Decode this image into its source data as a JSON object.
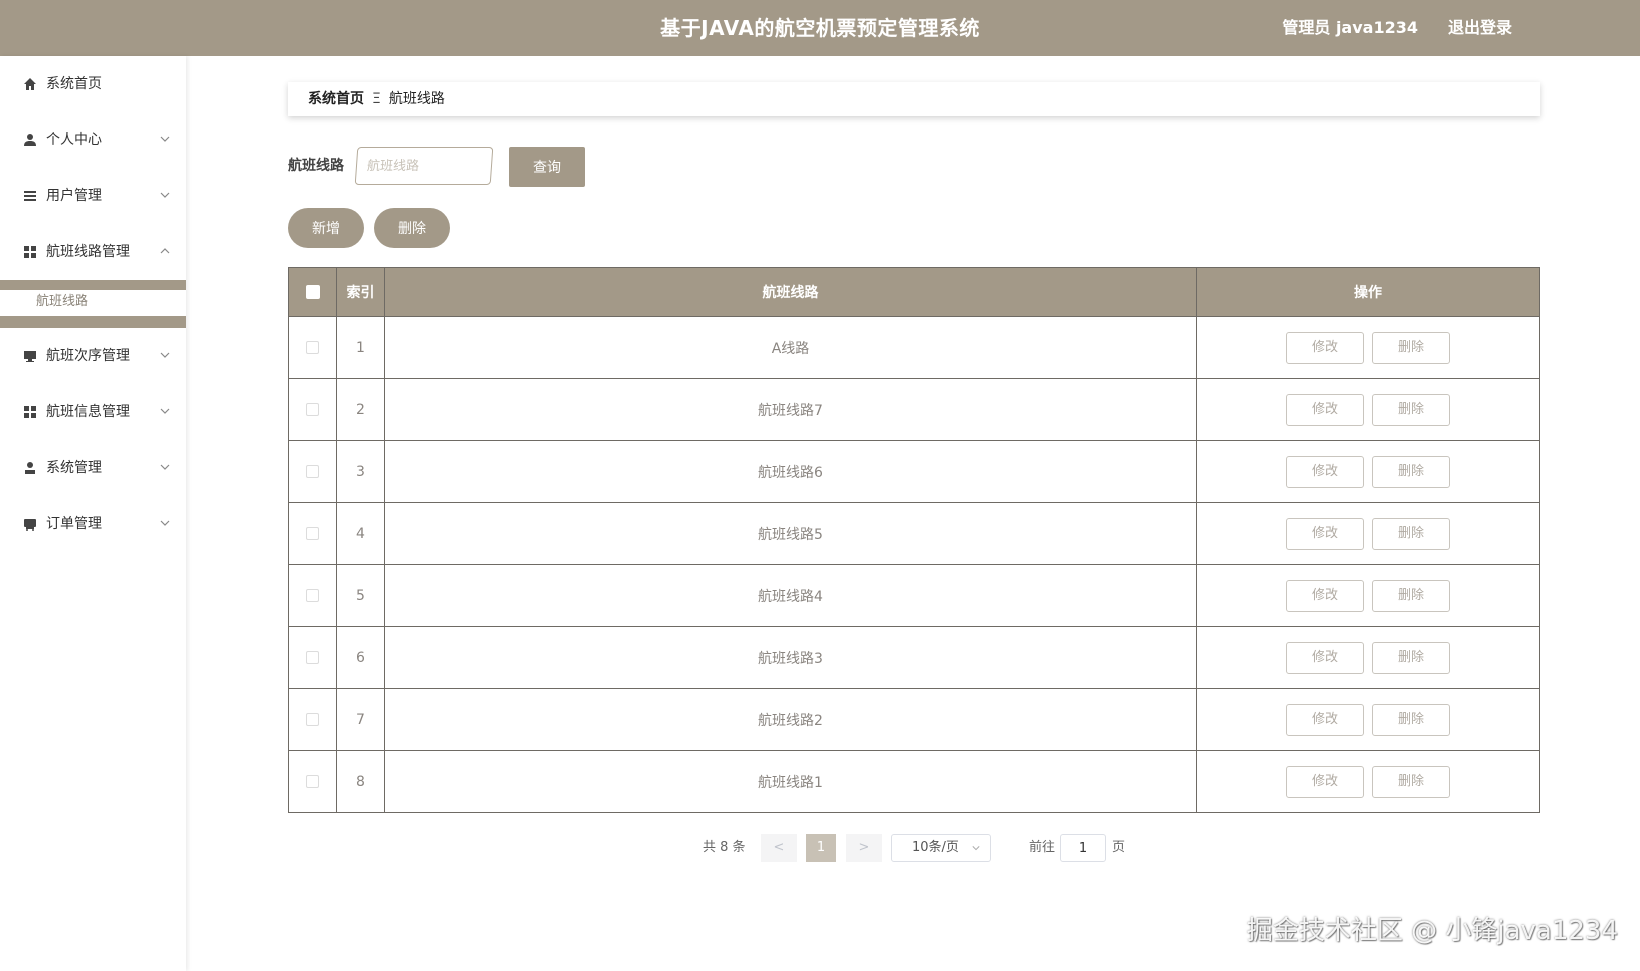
{
  "header": {
    "title": "基于JAVA的航空机票预定管理系统",
    "admin_label": "管理员 java1234",
    "logout_label": "退出登录"
  },
  "sidebar": {
    "items": [
      {
        "label": "系统首页",
        "icon": "home-icon",
        "expandable": false
      },
      {
        "label": "个人中心",
        "icon": "user-icon",
        "expandable": true
      },
      {
        "label": "用户管理",
        "icon": "list-icon",
        "expandable": true
      },
      {
        "label": "航班线路管理",
        "icon": "grid-icon",
        "expandable": true,
        "expanded": true
      },
      {
        "label": "航班次序管理",
        "icon": "monitor-icon",
        "expandable": true
      },
      {
        "label": "航班信息管理",
        "icon": "grid-icon",
        "expandable": true
      },
      {
        "label": "系统管理",
        "icon": "person-icon",
        "expandable": true
      },
      {
        "label": "订单管理",
        "icon": "cart-icon",
        "expandable": true
      }
    ],
    "submenu": {
      "label": "航班线路"
    }
  },
  "breadcrumb": {
    "home": "系统首页",
    "separator": "Ξ",
    "current": "航班线路"
  },
  "search": {
    "label": "航班线路",
    "placeholder": "航班线路",
    "query_label": "查询"
  },
  "actions": {
    "add_label": "新增",
    "delete_label": "删除"
  },
  "table": {
    "columns": [
      "索引",
      "航班线路",
      "操作"
    ],
    "rows": [
      {
        "index": "1",
        "route": "A线路"
      },
      {
        "index": "2",
        "route": "航班线路7"
      },
      {
        "index": "3",
        "route": "航班线路6"
      },
      {
        "index": "4",
        "route": "航班线路5"
      },
      {
        "index": "5",
        "route": "航班线路4"
      },
      {
        "index": "6",
        "route": "航班线路3"
      },
      {
        "index": "7",
        "route": "航班线路2"
      },
      {
        "index": "8",
        "route": "航班线路1"
      }
    ],
    "edit_label": "修改",
    "delete_label": "删除"
  },
  "pager": {
    "total": "共 8 条",
    "prev": "<",
    "current_page": "1",
    "next": ">",
    "page_size": "10条/页",
    "goto_label": "前往",
    "goto_value": "1",
    "page_label": "页"
  },
  "watermark": "掘金技术社区 @ 小锋java1234",
  "colors": {
    "accent": "#a39988",
    "border": "#6e6a64"
  }
}
